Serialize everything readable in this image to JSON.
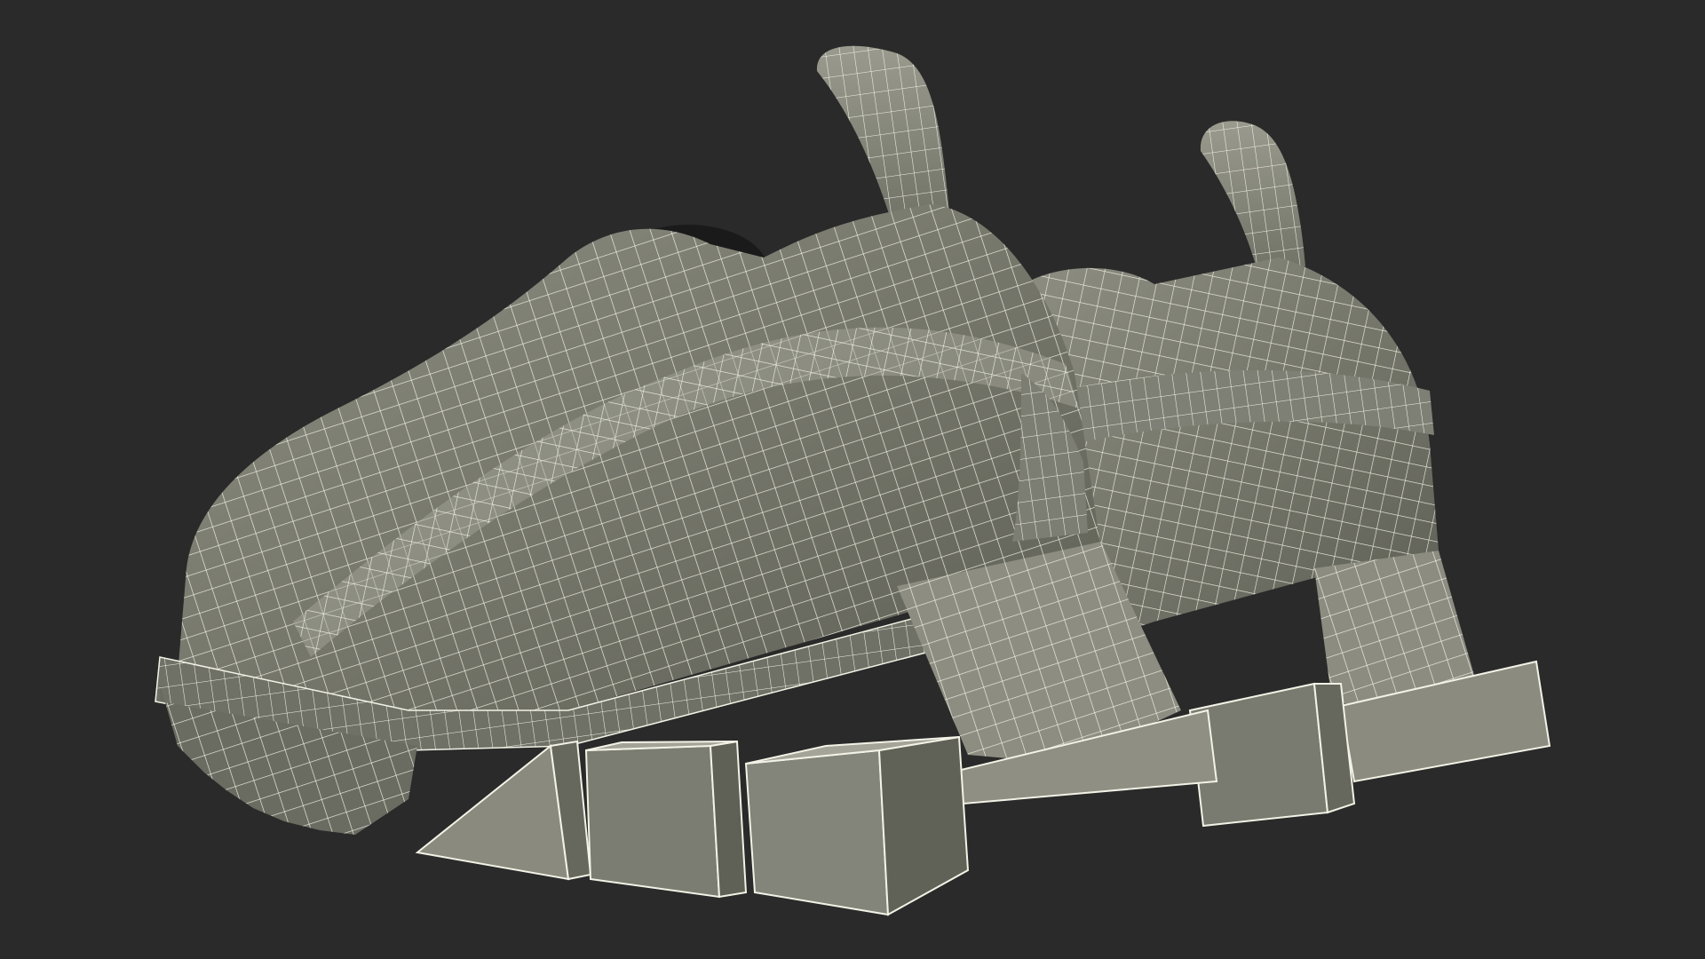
{
  "scene": {
    "background_color": "#2a2a2a",
    "mesh_fill_color": "#8a8b7e",
    "mesh_shadow_color": "#5e5f55",
    "mesh_highlight_color": "#a3a497",
    "wire_color": "#f2f2e6",
    "opening_color": "#1a1a1a",
    "object_icon": "sneaker-icon",
    "objects": [
      "left-sneaker",
      "right-sneaker"
    ]
  }
}
